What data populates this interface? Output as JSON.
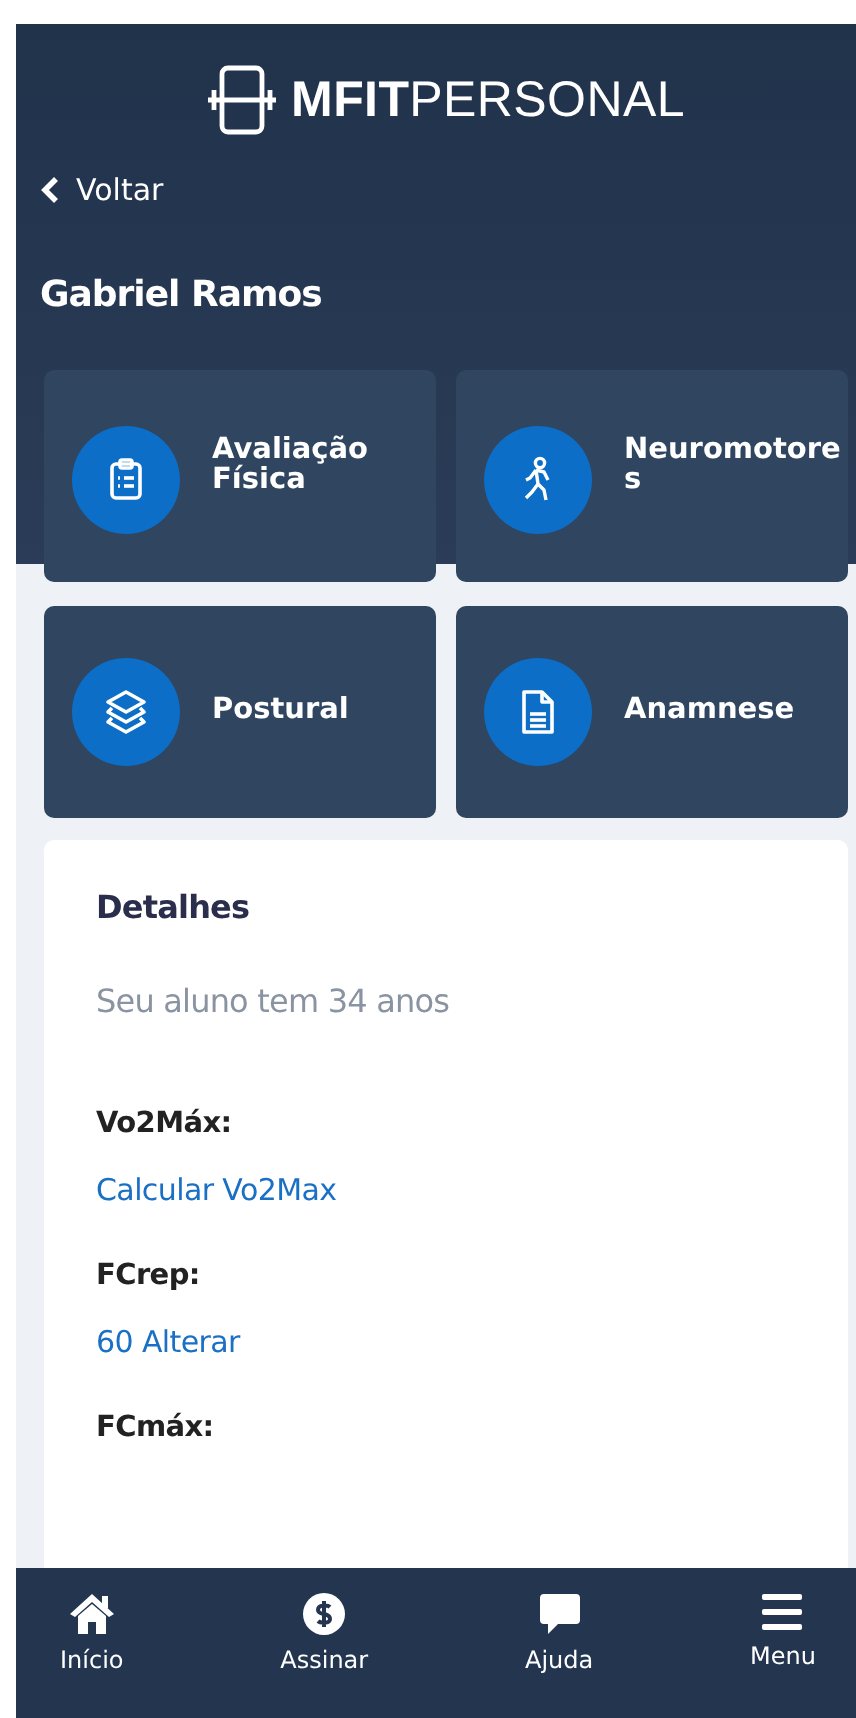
{
  "header": {
    "logo_bold": "MFIT",
    "logo_light": "PERSONAL",
    "back": "Voltar",
    "student_name": "Gabriel Ramos"
  },
  "tiles": [
    {
      "label": "Avaliação Física"
    },
    {
      "label": "Neuromotores"
    },
    {
      "label": "Postural"
    },
    {
      "label": "Anamnese"
    }
  ],
  "details": {
    "title": "Detalhes",
    "age_text": "Seu aluno tem 34 anos",
    "fields": [
      {
        "label": "Vo2Máx:",
        "value": "Calcular Vo2Max"
      },
      {
        "label": "FCrep:",
        "value": "60 Alterar"
      },
      {
        "label": "FCmáx:"
      }
    ]
  },
  "bottom_nav": [
    {
      "label": "Início"
    },
    {
      "label": "Assinar"
    },
    {
      "label": "Ajuda"
    },
    {
      "label": "Menu"
    }
  ]
}
